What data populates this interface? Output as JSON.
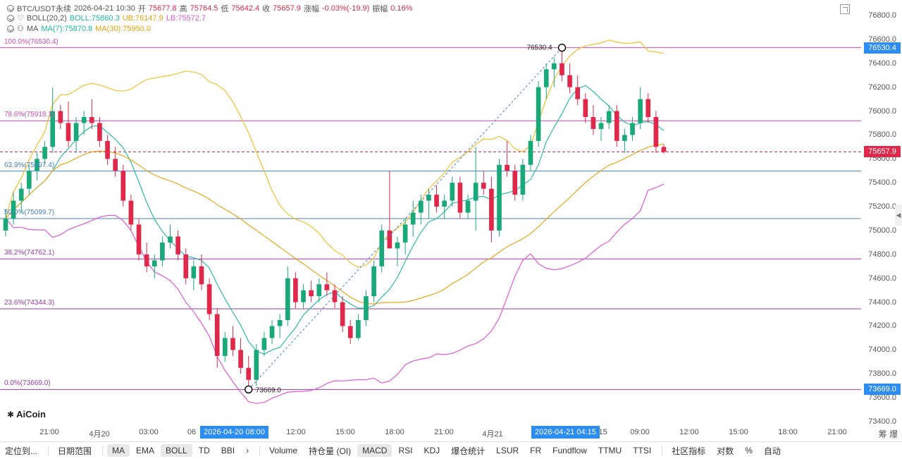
{
  "legend": {
    "symbol": "BTC/USDT永续",
    "datetime": "2026-04-21 10:30",
    "open_label": "开",
    "open": "75677.8",
    "high_label": "高",
    "high": "75764.5",
    "low_label": "低",
    "low": "75642.4",
    "close_label": "收",
    "close": "75657.9",
    "change_label": "涨幅",
    "change": "-0.03%(-19.9)",
    "amp_label": "振幅",
    "amp": "0.16%",
    "boll_name": "BOLL(20,2)",
    "boll_mid": "BOLL:75860.3",
    "boll_ub": "UB:76147.9",
    "boll_lb": "LB:75572.7",
    "ma_name": "MA",
    "ma7": "MA(7):75870.8",
    "ma30": "MA(30):75950.0"
  },
  "colors": {
    "up": "#19a978",
    "down": "#e0294a",
    "boll_upper": "#f2c12e",
    "boll_lower": "#e15ad6",
    "ma7": "#1bb8a8",
    "ma30": "#e8a20a",
    "accent": "#2d8cf0"
  },
  "y_axis": {
    "ticks": [
      "76800.0",
      "76600.0",
      "76400.0",
      "76200.0",
      "76000.0",
      "75800.0",
      "75600.0",
      "75400.0",
      "75200.0",
      "75000.0",
      "74800.0",
      "74600.0",
      "74400.0",
      "74200.0",
      "74000.0",
      "73800.0",
      "73600.0",
      "73400.0"
    ],
    "current_price": "75657.9",
    "high_tag": "76530.4",
    "low_tag": "73669.0"
  },
  "x_axis": {
    "ticks": [
      "21:00",
      "4月20",
      "03:00",
      "06",
      "09:00",
      "12:00",
      "15:00",
      "18:00",
      "21:00",
      "4月21",
      "04:15",
      "09:00",
      "12:00",
      "15:00",
      "18:00",
      "21:00"
    ],
    "tag_left": "2026-04-20 08:00",
    "tag_right": "2026-04-21 04:15"
  },
  "fib_levels": [
    {
      "label": "100.0%(76530.4)",
      "price": 76530.4,
      "color": "#d44cb5"
    },
    {
      "label": "78.6%(75918.1)",
      "price": 75918.1,
      "color": "#d44cb5"
    },
    {
      "label": "63.9%(75497.4)",
      "price": 75497.4,
      "color": "#4a7fc4"
    },
    {
      "label": "50.0%(75099.7)",
      "price": 75099.7,
      "color": "#4a7fc4"
    },
    {
      "label": "38.2%(74762.1)",
      "price": 74762.1,
      "color": "#9b3aa8"
    },
    {
      "label": "23.6%(74344.3)",
      "price": 74344.3,
      "color": "#9b3aa8"
    },
    {
      "label": "0.0%(73669.0)",
      "price": 73669.0,
      "color": "#9b3aa8"
    }
  ],
  "annotations": {
    "high_point": "76530.4",
    "low_point": "73669.0"
  },
  "logo": {
    "text": "AiCoin"
  },
  "toolbar": {
    "left": [
      "定位到...",
      "日期范围"
    ],
    "indicators_main": [
      "MA",
      "EMA",
      "BOLL",
      "TD",
      "BBI"
    ],
    "indicators_sub": [
      "Volume",
      "持仓量 (OI)",
      "MACD",
      "RSI",
      "KDJ",
      "爆仓统计",
      "LSUR",
      "FR",
      "Fundflow",
      "TTMU",
      "TTSI"
    ],
    "right": [
      "社区指标",
      "对数",
      "%",
      "自动"
    ],
    "active": [
      "MA",
      "BOLL",
      "MACD"
    ]
  },
  "corner_label": "筹 爆",
  "chart_data": {
    "type": "candlestick",
    "symbol": "BTC/USDT永续",
    "interval_note": "",
    "ylim": [
      73400,
      76800
    ],
    "candles": [
      [
        75000,
        75180,
        74950,
        75100
      ],
      [
        75100,
        75320,
        75050,
        75250
      ],
      [
        75250,
        75400,
        75150,
        75350
      ],
      [
        75350,
        75550,
        75300,
        75500
      ],
      [
        75500,
        75650,
        75420,
        75600
      ],
      [
        75600,
        75750,
        75550,
        75700
      ],
      [
        75700,
        76200,
        75650,
        76000
      ],
      [
        76000,
        76050,
        75850,
        75900
      ],
      [
        75900,
        76080,
        75700,
        75750
      ],
      [
        75750,
        75950,
        75650,
        75900
      ],
      [
        75900,
        76000,
        75800,
        75950
      ],
      [
        75950,
        76100,
        75850,
        75900
      ],
      [
        75900,
        75950,
        75700,
        75750
      ],
      [
        75750,
        75800,
        75550,
        75600
      ],
      [
        75600,
        75700,
        75450,
        75500
      ],
      [
        75500,
        75550,
        75200,
        75250
      ],
      [
        75250,
        75300,
        75000,
        75050
      ],
      [
        75050,
        75100,
        74750,
        74800
      ],
      [
        74800,
        74900,
        74650,
        74700
      ],
      [
        74700,
        74800,
        74600,
        74750
      ],
      [
        74750,
        74950,
        74700,
        74900
      ],
      [
        74900,
        75050,
        74850,
        74950
      ],
      [
        74950,
        75000,
        74750,
        74800
      ],
      [
        74800,
        74850,
        74550,
        74600
      ],
      [
        74600,
        74750,
        74500,
        74700
      ],
      [
        74700,
        74800,
        74500,
        74550
      ],
      [
        74550,
        74600,
        74250,
        74300
      ],
      [
        74300,
        74350,
        73850,
        73950
      ],
      [
        73950,
        74150,
        73900,
        74100
      ],
      [
        74100,
        74200,
        73950,
        74000
      ],
      [
        74000,
        74100,
        73800,
        73850
      ],
      [
        73850,
        73950,
        73669,
        73750
      ],
      [
        73750,
        74050,
        73700,
        74000
      ],
      [
        74000,
        74150,
        73950,
        74100
      ],
      [
        74100,
        74250,
        74050,
        74200
      ],
      [
        74200,
        74300,
        74100,
        74250
      ],
      [
        74250,
        74700,
        74200,
        74600
      ],
      [
        74600,
        74650,
        74350,
        74400
      ],
      [
        74400,
        74550,
        74350,
        74500
      ],
      [
        74500,
        74580,
        74400,
        74450
      ],
      [
        74450,
        74600,
        74400,
        74550
      ],
      [
        74550,
        74650,
        74450,
        74500
      ],
      [
        74500,
        74550,
        74350,
        74400
      ],
      [
        74400,
        74450,
        74150,
        74200
      ],
      [
        74200,
        74250,
        74050,
        74100
      ],
      [
        74100,
        74300,
        74080,
        74250
      ],
      [
        74250,
        74500,
        74200,
        74450
      ],
      [
        74450,
        74750,
        74400,
        74700
      ],
      [
        74700,
        75050,
        74650,
        75000
      ],
      [
        75000,
        75500,
        74950,
        74850
      ],
      [
        74850,
        74950,
        74700,
        74900
      ],
      [
        74900,
        75100,
        74800,
        75050
      ],
      [
        75050,
        75250,
        74950,
        75150
      ],
      [
        75150,
        75300,
        75050,
        75250
      ],
      [
        75250,
        75350,
        75100,
        75300
      ],
      [
        75300,
        75380,
        75150,
        75200
      ],
      [
        75200,
        75300,
        75100,
        75250
      ],
      [
        75250,
        75450,
        75200,
        75400
      ],
      [
        75400,
        75450,
        75100,
        75150
      ],
      [
        75150,
        75300,
        75100,
        75250
      ],
      [
        75250,
        75700,
        75000,
        75400
      ],
      [
        75400,
        75500,
        75300,
        75350
      ],
      [
        75350,
        75450,
        74900,
        75000
      ],
      [
        75000,
        75600,
        74950,
        75550
      ],
      [
        75550,
        75750,
        75450,
        75500
      ],
      [
        75500,
        75550,
        75250,
        75300
      ],
      [
        75300,
        75600,
        75250,
        75550
      ],
      [
        75550,
        75800,
        75500,
        75750
      ],
      [
        75750,
        76250,
        75700,
        76200
      ],
      [
        76200,
        76400,
        76100,
        76350
      ],
      [
        76350,
        76450,
        76200,
        76400
      ],
      [
        76400,
        76530.4,
        76250,
        76300
      ],
      [
        76300,
        76400,
        76150,
        76200
      ],
      [
        76200,
        76300,
        76050,
        76100
      ],
      [
        76100,
        76150,
        75900,
        75950
      ],
      [
        75950,
        76050,
        75800,
        75850
      ],
      [
        75850,
        75950,
        75750,
        75900
      ],
      [
        75900,
        76050,
        75850,
        76000
      ],
      [
        76000,
        76050,
        75700,
        75750
      ],
      [
        75750,
        75850,
        75650,
        75800
      ],
      [
        75800,
        75950,
        75750,
        75900
      ],
      [
        75900,
        76200,
        75850,
        76100
      ],
      [
        76100,
        76150,
        75900,
        75950
      ],
      [
        75950,
        76000,
        75650,
        75700
      ],
      [
        75700,
        75720,
        75642.4,
        75657.9
      ]
    ]
  }
}
